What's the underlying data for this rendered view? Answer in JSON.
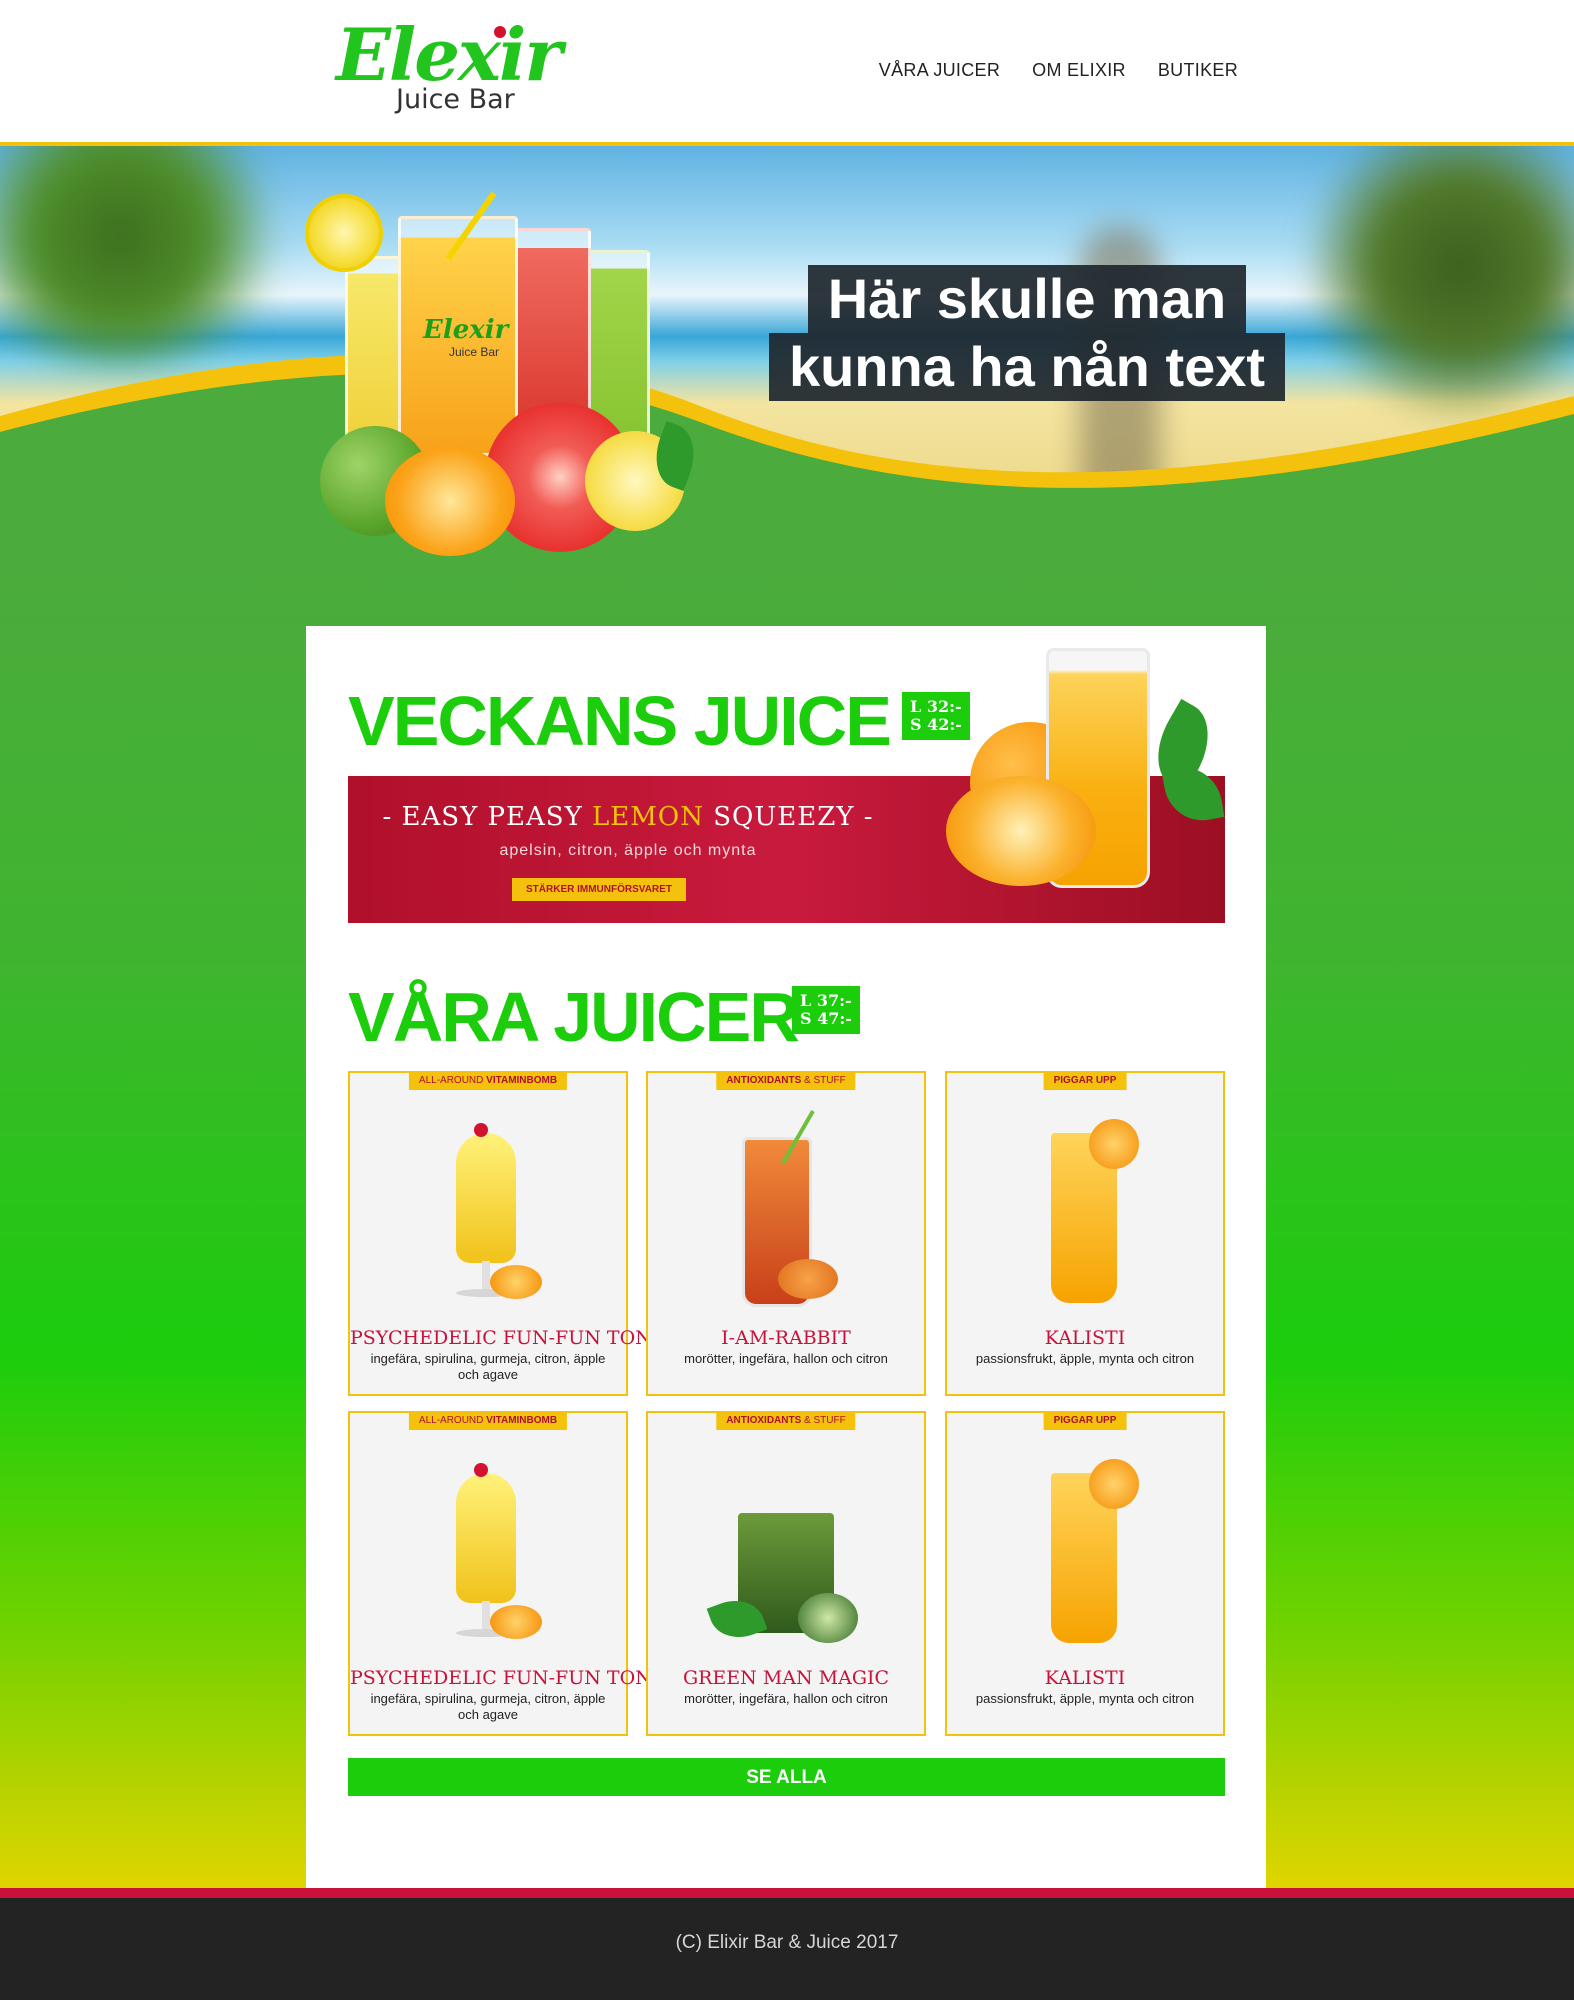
{
  "brand": {
    "name": "Elexir",
    "sub": "Juice Bar"
  },
  "nav": {
    "items": [
      "VÅRA JUICER",
      "OM ELIXIR",
      "BUTIKER"
    ]
  },
  "hero": {
    "line1": "Här skulle man",
    "line2": "kunna ha nån text",
    "glass_brand": "Elexir",
    "glass_sub": "Juice Bar"
  },
  "weekly": {
    "title": "VECKANS JUICE",
    "price_l": "L 32:-",
    "price_s": "S 42:-",
    "promo_prefix": "- EASY PEASY ",
    "promo_accent": "LEMON",
    "promo_suffix": " SQUEEZY -",
    "promo_sub": "apelsin, citron, äpple och mynta",
    "promo_tag": "STÄRKER IMMUNFÖRSVARET"
  },
  "juices": {
    "title": "VÅRA JUICER",
    "price_l": "L 37:-",
    "price_s": "S 47:-",
    "items": [
      {
        "tag_a": "ALL-AROUND ",
        "tag_b": "VITAMINBOMB",
        "name": "PSYCHEDELIC FUN-FUN TONIK",
        "desc": "ingefära, spirulina, gurmeja, citron, äpple och agave"
      },
      {
        "tag_a": "ANTIOXIDANTS",
        "tag_b": " & STUFF",
        "name": "I-AM-RABBIT",
        "desc": "morötter, ingefära, hallon och citron"
      },
      {
        "tag_a": "PIGGAR UPP",
        "tag_b": "",
        "name": "KALISTI",
        "desc": "passionsfrukt, äpple, mynta och citron"
      },
      {
        "tag_a": "ALL-AROUND ",
        "tag_b": "VITAMINBOMB",
        "name": "PSYCHEDELIC FUN-FUN TONIK",
        "desc": "ingefära, spirulina, gurmeja, citron, äpple och agave"
      },
      {
        "tag_a": "ANTIOXIDANTS",
        "tag_b": " & STUFF",
        "name": "GREEN MAN MAGIC",
        "desc": "morötter, ingefära, hallon och citron"
      },
      {
        "tag_a": "PIGGAR UPP",
        "tag_b": "",
        "name": "KALISTI",
        "desc": "passionsfrukt, äpple, mynta och citron"
      }
    ],
    "see_all": "SE ALLA"
  },
  "footer": {
    "text": "(C) Elixir Bar & Juice 2017"
  },
  "colors": {
    "green": "#1ccd0c",
    "yellow": "#f4c20d",
    "red": "#c8123a",
    "dark": "#232323"
  }
}
